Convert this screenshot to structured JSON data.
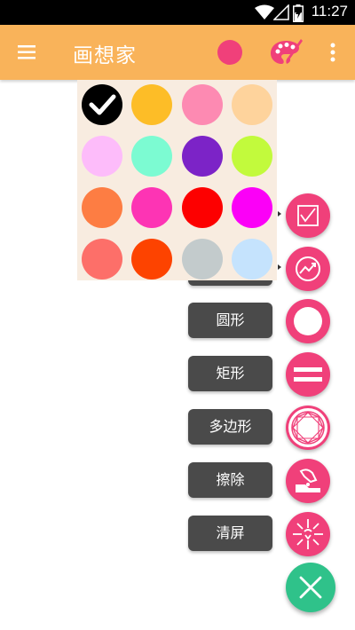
{
  "status_bar": {
    "time": "11:27",
    "battery_level": 0.6
  },
  "app_bar": {
    "title": "画想家",
    "current_color": "#f0407a",
    "accent_color": "#f9b35a"
  },
  "palette": {
    "background": "#f8ece0",
    "swatches": [
      "#000000",
      "#fdbd27",
      "#fd8ab2",
      "#fed39c",
      "#fdbcfa",
      "#7cfbd2",
      "#7c23c7",
      "#c2fa3c",
      "#fd7d43",
      "#fd34b4",
      "#fd0000",
      "#fb00f7",
      "#fd6f69",
      "#fd4300",
      "#c3cbcc",
      "#c5e3fd"
    ],
    "selected_index": 0
  },
  "tools": [
    {
      "label": "",
      "icon": "line-chart-icon"
    },
    {
      "label": "",
      "icon": "trend-icon"
    },
    {
      "label": "圆形",
      "icon": "circle-outline-icon"
    },
    {
      "label": "矩形",
      "icon": "rectangle-icon"
    },
    {
      "label": "多边形",
      "icon": "polygon-icon"
    },
    {
      "label": "擦除",
      "icon": "eraser-icon"
    },
    {
      "label": "清屏",
      "icon": "clear-screen-icon"
    }
  ],
  "fab": {
    "icon": "close-icon",
    "color": "#2fc28a",
    "tool_color": "#f0407a"
  }
}
